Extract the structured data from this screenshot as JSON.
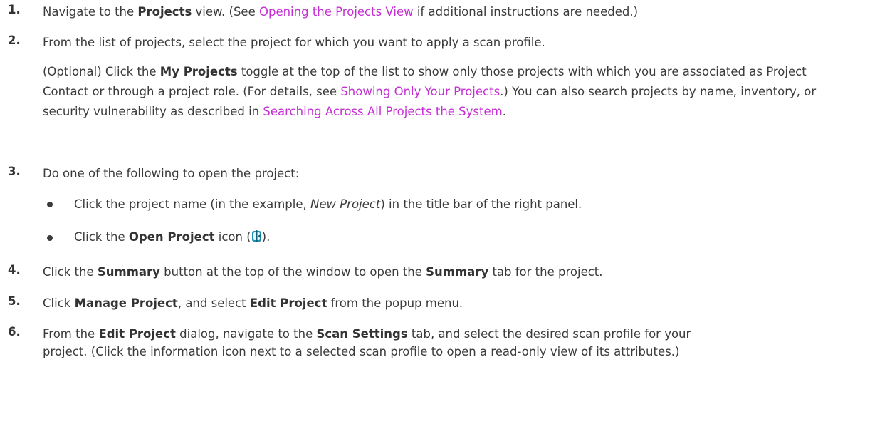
{
  "steps": [
    {
      "num": "1.",
      "t1": "Navigate to the ",
      "b1": "Projects",
      "t2": " view. (See ",
      "link": "Opening the Projects View",
      "t3": " if additional instructions are needed.)"
    },
    {
      "num": "2.",
      "t1": "From the list of projects, select the project for which you want to apply a scan profile.",
      "opt": {
        "t1": "(Optional) Click the ",
        "b1": "My Projects",
        "t2": " toggle at the top of the list to show only those projects with which you are associated as Project Contact or through a project role. (For details, see ",
        "link1": "Showing Only Your Projects",
        "t3": ".) You can also search projects by name, inventory, or security vulnerability as described in ",
        "link2": "Searching Across All Projects the System",
        "t4": "."
      }
    },
    {
      "num": "3.",
      "t1": "Do one of the following to open the project:",
      "bullets": [
        {
          "t1": "Click the project name (in the example, ",
          "i1": "New Project",
          "t2": ") in the title bar of the right panel."
        },
        {
          "t1": "Click the ",
          "b1": "Open Project",
          "t2": " icon (",
          "icon": "open-project-icon",
          "t3": ")."
        }
      ]
    },
    {
      "num": "4.",
      "t1": "Click the ",
      "b1": "Summary",
      "t2": " button at the top of the window to open the ",
      "b2": "Summary",
      "t3": " tab for the project."
    },
    {
      "num": "5.",
      "t1": "Click ",
      "b1": "Manage Project",
      "t2": ", and select ",
      "b2": "Edit Project",
      "t3": " from the popup menu."
    },
    {
      "num": "6.",
      "t1": "From the ",
      "b1": "Edit Project",
      "t2": " dialog, navigate to the ",
      "b2": "Scan Settings",
      "t3": " tab, and select the desired scan profile for your",
      "t4": "project. (Click the information icon next to a selected scan profile to open a read-only view of its attributes.)"
    }
  ],
  "colors": {
    "text": "#3b3b3b",
    "link": "#c42fd3",
    "icon": "#1a8fb3"
  }
}
